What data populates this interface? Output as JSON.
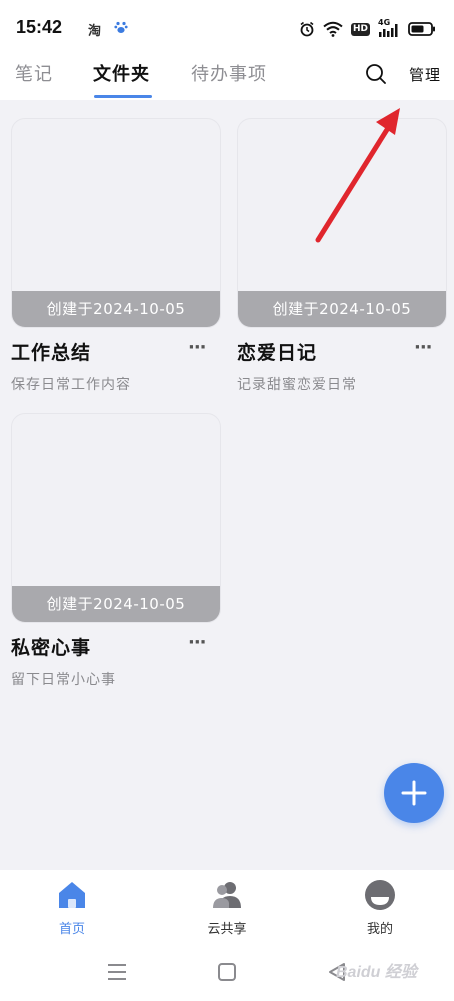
{
  "status_bar": {
    "time": "15:42",
    "app_icon_1": "淘",
    "app_icon_2": "paw-icon",
    "hd": "HD",
    "network": "4G"
  },
  "tabs": [
    {
      "label": "笔记",
      "active": false
    },
    {
      "label": "文件夹",
      "active": true
    },
    {
      "label": "待办事项",
      "active": false
    }
  ],
  "header": {
    "search_icon": "search-icon",
    "manage_label": "管理"
  },
  "folders": [
    {
      "date": "创建于2024-10-05",
      "title": "工作总结",
      "more": "···",
      "desc": "保存日常工作内容"
    },
    {
      "date": "创建于2024-10-05",
      "title": "恋爱日记",
      "more": "···",
      "desc": "记录甜蜜恋爱日常"
    },
    {
      "date": "创建于2024-10-05",
      "title": "私密心事",
      "more": "···",
      "desc": "留下日常小心事"
    }
  ],
  "fab": {
    "icon": "plus-icon"
  },
  "bottom_nav": [
    {
      "label": "首页",
      "icon": "home-icon",
      "active": true
    },
    {
      "label": "云共享",
      "icon": "users-icon",
      "active": false
    },
    {
      "label": "我的",
      "icon": "profile-icon",
      "active": false
    }
  ],
  "watermark": "Baidu 经验",
  "colors": {
    "accent": "#4a86e8",
    "date_bar": "#a9a9ad",
    "background": "#f2f2f6",
    "arrow": "#e0262d"
  }
}
